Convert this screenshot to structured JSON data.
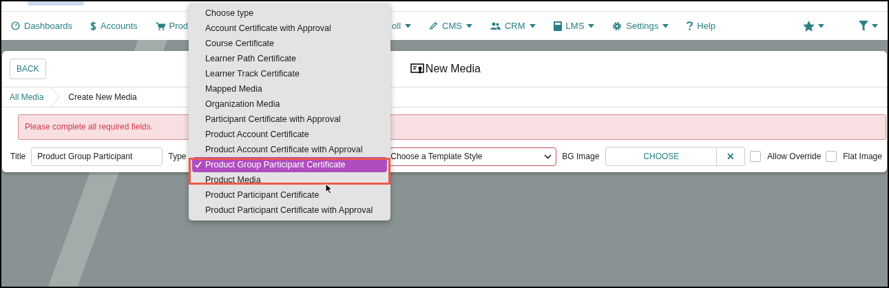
{
  "nav": {
    "items": [
      {
        "label": "Dashboards",
        "menu": false
      },
      {
        "label": "Accounts",
        "menu": false
      },
      {
        "label": "Prod",
        "menu": false
      },
      {
        "label": "oll",
        "menu": true
      },
      {
        "label": "CMS",
        "menu": true
      },
      {
        "label": "CRM",
        "menu": true
      },
      {
        "label": "LMS",
        "menu": true
      },
      {
        "label": "Settings",
        "menu": true
      },
      {
        "label": "Help",
        "menu": false
      }
    ],
    "right_menus": [
      {
        "menu": true
      },
      {
        "menu": true
      }
    ]
  },
  "page": {
    "back_button": "BACK",
    "title": "New Media",
    "breadcrumbs": [
      {
        "label": "All Media",
        "link": true
      },
      {
        "label": "Create New Media",
        "link": false
      }
    ],
    "alert": "Please complete all required fields."
  },
  "form": {
    "title_label": "Title",
    "title_value": "Product Group Participant",
    "type_label": "Type",
    "template_select": {
      "placeholder": "Choose a Template Style",
      "invalid": true
    },
    "bg_image_label": "BG Image",
    "choose_button": "CHOOSE",
    "clear_button": "✕",
    "checkboxes": [
      {
        "label": "Allow Override",
        "checked": false
      },
      {
        "label": "Flat Image",
        "checked": false
      }
    ]
  },
  "type_dropdown": {
    "options": [
      {
        "label": "Choose type",
        "selected": false
      },
      {
        "label": "Account Certificate with Approval",
        "selected": false
      },
      {
        "label": "Course Certificate",
        "selected": false
      },
      {
        "label": "Learner Path Certificate",
        "selected": false
      },
      {
        "label": "Learner Track Certificate",
        "selected": false
      },
      {
        "label": "Mapped Media",
        "selected": false
      },
      {
        "label": "Organization Media",
        "selected": false
      },
      {
        "label": "Participant Certificate with Approval",
        "selected": false
      },
      {
        "label": "Product Account Certificate",
        "selected": false
      },
      {
        "label": "Product Account Certificate with Approval",
        "selected": false
      },
      {
        "label": "Product Group Participant Certificate",
        "selected": true
      },
      {
        "label": "Product Media",
        "selected": false
      },
      {
        "label": "Product Participant Certificate",
        "selected": false
      },
      {
        "label": "Product Participant Certificate with Approval",
        "selected": false
      }
    ]
  }
}
